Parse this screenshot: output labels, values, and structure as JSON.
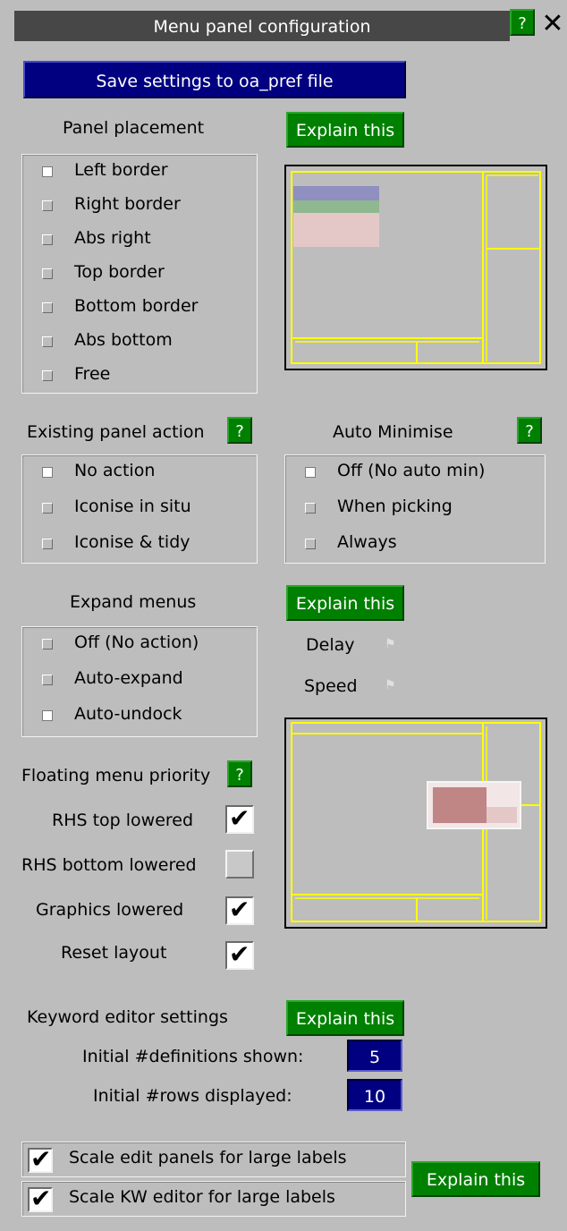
{
  "window": {
    "title": "Menu panel configuration",
    "help_label": "?"
  },
  "save_label": "Save settings to oa_pref file",
  "placement": {
    "heading": "Panel placement",
    "explain_label": "Explain this",
    "options": [
      {
        "label": "Left border",
        "selected": true
      },
      {
        "label": "Right border",
        "selected": false
      },
      {
        "label": "Abs right",
        "selected": false
      },
      {
        "label": "Top border",
        "selected": false
      },
      {
        "label": "Bottom border",
        "selected": false
      },
      {
        "label": "Abs bottom",
        "selected": false
      },
      {
        "label": "Free",
        "selected": false
      }
    ]
  },
  "existing": {
    "heading": "Existing panel action",
    "help_label": "?",
    "options": [
      {
        "label": "No action",
        "selected": true
      },
      {
        "label": "Iconise in situ",
        "selected": false
      },
      {
        "label": "Iconise & tidy",
        "selected": false
      }
    ]
  },
  "auto_min": {
    "heading": "Auto Minimise",
    "help_label": "?",
    "options": [
      {
        "label": "Off (No auto min)",
        "selected": true
      },
      {
        "label": "When picking",
        "selected": false
      },
      {
        "label": "Always",
        "selected": false
      }
    ]
  },
  "expand": {
    "heading": "Expand menus",
    "explain_label": "Explain this",
    "options": [
      {
        "label": "Off (No action)",
        "selected": false
      },
      {
        "label": "Auto-expand",
        "selected": false
      },
      {
        "label": "Auto-undock",
        "selected": true
      }
    ],
    "delay_label": "Delay",
    "speed_label": "Speed"
  },
  "floating": {
    "heading": "Floating menu priority",
    "help_label": "?",
    "items": [
      {
        "label": "RHS top lowered",
        "checked": true
      },
      {
        "label": "RHS bottom lowered",
        "checked": false
      },
      {
        "label": "Graphics lowered",
        "checked": true
      },
      {
        "label": "Reset layout",
        "checked": true
      }
    ]
  },
  "keyword": {
    "heading": "Keyword editor settings",
    "explain_label": "Explain this",
    "definitions_label": "Initial #definitions shown:",
    "definitions_value": "5",
    "rows_label": "Initial #rows displayed:",
    "rows_value": "10"
  },
  "scale": {
    "edit_label": "Scale edit panels for large labels",
    "edit_checked": true,
    "kw_label": "Scale KW editor for large labels",
    "kw_checked": true,
    "explain_label": "Explain this"
  },
  "colors": {
    "panel_bg": "#bdbdbd",
    "title_bg": "#474747",
    "save_bg": "#000080",
    "explain_bg": "#008000",
    "preview_line": "#ffff00",
    "preview_blue": "#8f8fc0",
    "preview_green": "#8fb890",
    "preview_pink": "#e4c8c8",
    "preview_red": "#c08585"
  }
}
